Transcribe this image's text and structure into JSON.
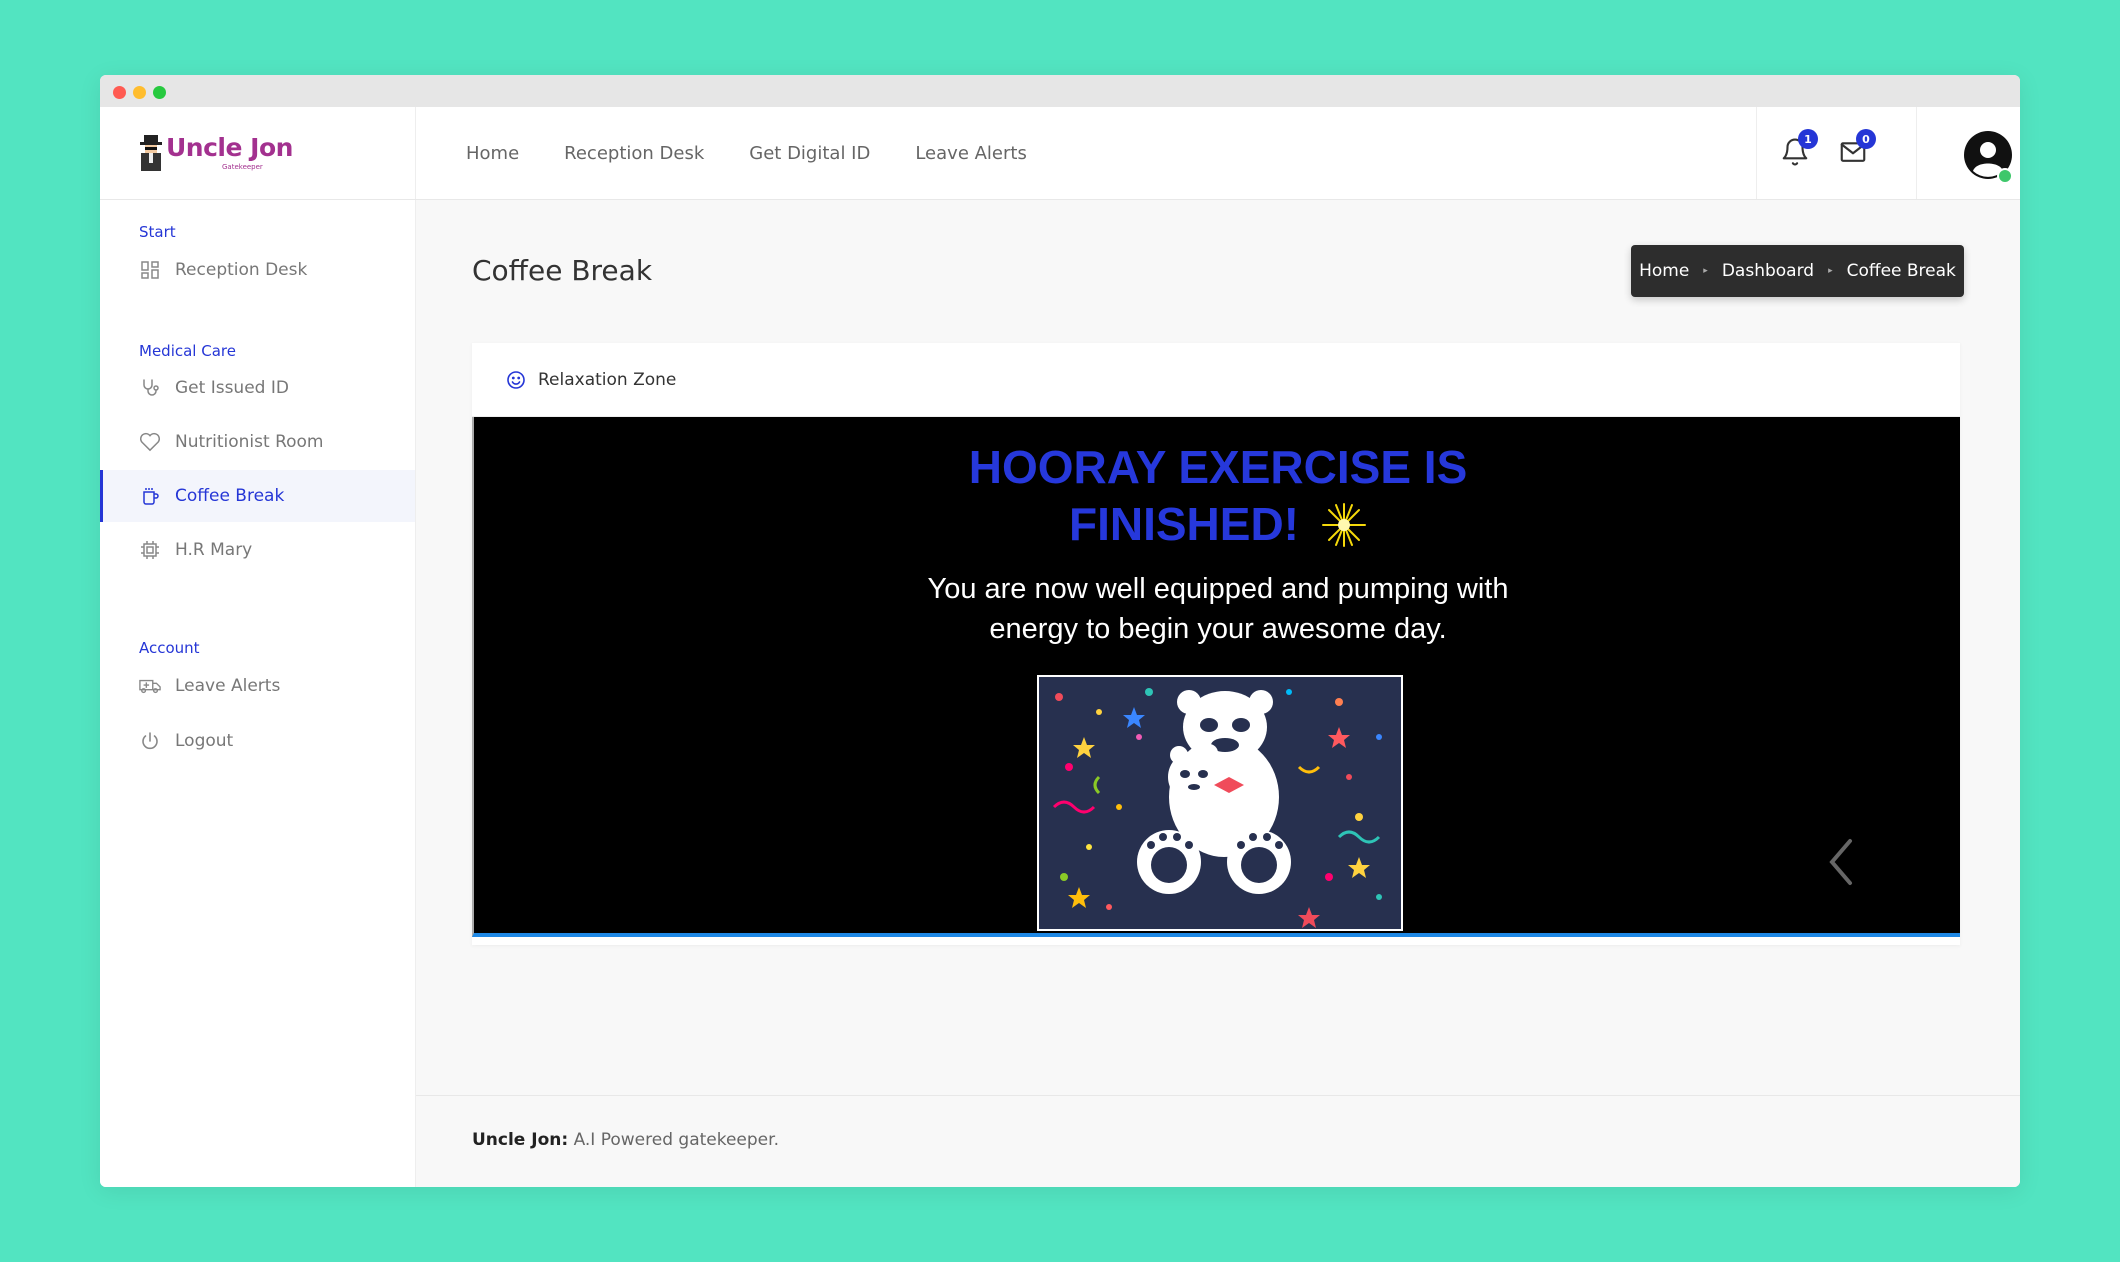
{
  "brand": {
    "name": "Uncle Jon",
    "subtitle": "Gatekeeper"
  },
  "topnav": [
    "Home",
    "Reception Desk",
    "Get Digital ID",
    "Leave Alerts"
  ],
  "notifications": {
    "bell_count": "1",
    "mail_count": "0"
  },
  "sidebar": {
    "sections": [
      {
        "title": "Start",
        "items": [
          {
            "label": "Reception Desk",
            "icon": "grid-icon"
          }
        ]
      },
      {
        "title": "Medical Care",
        "items": [
          {
            "label": "Get Issued ID",
            "icon": "stethoscope-icon"
          },
          {
            "label": "Nutritionist Room",
            "icon": "heart-icon"
          },
          {
            "label": "Coffee Break",
            "icon": "coffee-cup-icon",
            "active": true
          },
          {
            "label": "H.R Mary",
            "icon": "chip-icon"
          }
        ]
      },
      {
        "title": "Account",
        "items": [
          {
            "label": "Leave Alerts",
            "icon": "ambulance-icon"
          },
          {
            "label": "Logout",
            "icon": "power-icon"
          }
        ]
      }
    ]
  },
  "page": {
    "title": "Coffee Break"
  },
  "breadcrumb": [
    "Home",
    "Dashboard",
    "Coffee Break"
  ],
  "card": {
    "title": "Relaxation Zone",
    "headline_line1": "HOORAY EXERCISE IS",
    "headline_line2": "FINISHED!",
    "message_line1": "You are now well equipped and pumping with",
    "message_line2": "energy to begin your awesome day."
  },
  "footer": {
    "brand": "Uncle Jon:",
    "text": " A.I Powered gatekeeper."
  },
  "colors": {
    "accent": "#2536d6",
    "background": "#52e4c1",
    "headline": "#2638db",
    "brand": "#a3318f"
  }
}
